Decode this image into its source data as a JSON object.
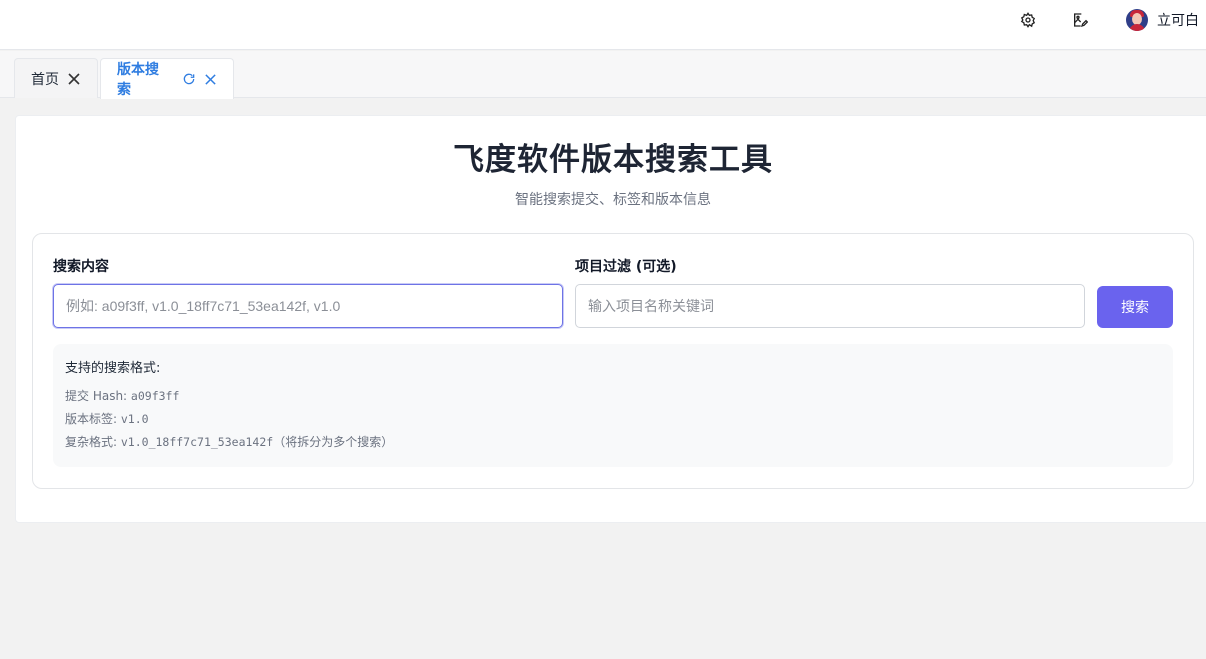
{
  "header": {
    "icons": [
      "gear-icon",
      "image-edit-icon"
    ],
    "user": {
      "name": "立可白"
    }
  },
  "tabs": [
    {
      "label": "首页",
      "active": false,
      "icons": [
        "close-icon"
      ]
    },
    {
      "label": "版本搜索",
      "active": true,
      "icons": [
        "refresh-icon",
        "close-icon"
      ]
    }
  ],
  "page": {
    "title": "飞度软件版本搜索工具",
    "subtitle": "智能搜索提交、标签和版本信息"
  },
  "form": {
    "search_label": "搜索内容",
    "search_placeholder": "例如: a09f3ff, v1.0_18ff7c71_53ea142f, v1.0",
    "search_value": "",
    "project_label": "项目过滤 (可选)",
    "project_placeholder": "输入项目名称关键词",
    "project_value": "",
    "search_button": "搜索"
  },
  "help": {
    "title": "支持的搜索格式:",
    "items": [
      {
        "prefix": "提交 Hash:",
        "code": "a09f3ff",
        "suffix": ""
      },
      {
        "prefix": "版本标签:",
        "code": "v1.0",
        "suffix": ""
      },
      {
        "prefix": "复杂格式:",
        "code": "v1.0_18ff7c71_53ea142f",
        "suffix": "（将拆分为多个搜索）"
      }
    ]
  },
  "colors": {
    "accent": "#6a63ee",
    "active_tab": "#2f7de1",
    "background": "#f2f2f2"
  }
}
